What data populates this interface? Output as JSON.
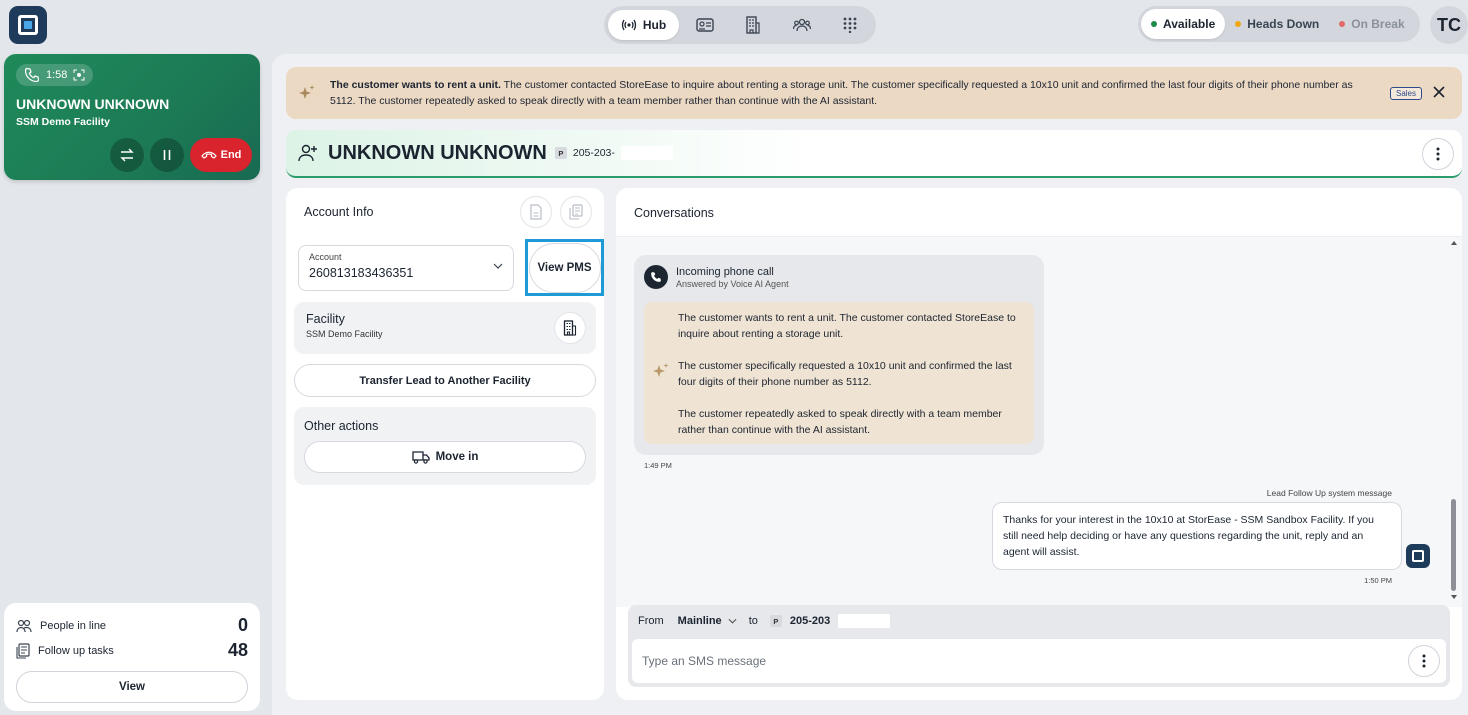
{
  "topbar": {
    "hub_label": "Hub",
    "statuses": [
      {
        "label": "Available",
        "color": "#1e8a4c",
        "active": true
      },
      {
        "label": "Heads Down",
        "color": "#f2a516",
        "active": false
      },
      {
        "label": "On Break",
        "color": "#e06a6a",
        "active": false
      }
    ],
    "user_initials": "TC"
  },
  "call": {
    "timer": "1:58",
    "caller_name": "UNKNOWN UNKNOWN",
    "facility": "SSM Demo Facility",
    "end_label": "End"
  },
  "queue": {
    "people_in_line_label": "People in line",
    "people_in_line_count": "0",
    "follow_up_label": "Follow up tasks",
    "follow_up_count": "48",
    "view_label": "View"
  },
  "banner": {
    "headline": "The customer wants to rent a unit.",
    "body": " The customer contacted StoreEase to inquire about renting a storage unit. The customer specifically requested a 10x10 unit and confirmed the last four digits of their phone number as 5112. The customer repeatedly asked to speak directly with a team member rather than continue with the AI assistant.",
    "tag": "Sales"
  },
  "header": {
    "title": "UNKNOWN UNKNOWN",
    "phone_badge": "P",
    "phone": "205-203-"
  },
  "account": {
    "title": "Account Info",
    "account_label": "Account",
    "account_value": "260813183436351",
    "view_pms_label": "View PMS",
    "facility_title": "Facility",
    "facility_name": "SSM Demo Facility",
    "transfer_label": "Transfer Lead to Another Facility",
    "other_actions_title": "Other actions",
    "move_in_label": "Move in"
  },
  "conversations": {
    "title": "Conversations",
    "call_title": "Incoming phone call",
    "call_subtitle": "Answered by Voice AI Agent",
    "summary": [
      "The customer wants to rent a unit. The customer contacted StoreEase to inquire about renting a storage unit.",
      "The customer specifically requested a 10x10 unit and confirmed the last four digits of their phone number as 5112.",
      "The customer repeatedly asked to speak directly with a team member rather than continue with the AI assistant."
    ],
    "call_time": "1:49 PM",
    "system_label": "Lead Follow Up system message",
    "outgoing_text": "Thanks for your interest in the 10x10 at StorEase - SSM Sandbox Facility. If you still need help deciding or have any questions regarding the unit, reply and an agent will assist.",
    "outgoing_time": "1:50 PM"
  },
  "composer": {
    "from_label": "From",
    "from_value": "Mainline",
    "to_label": "to",
    "to_badge": "P",
    "to_value": "205-203",
    "placeholder": "Type an SMS message"
  }
}
